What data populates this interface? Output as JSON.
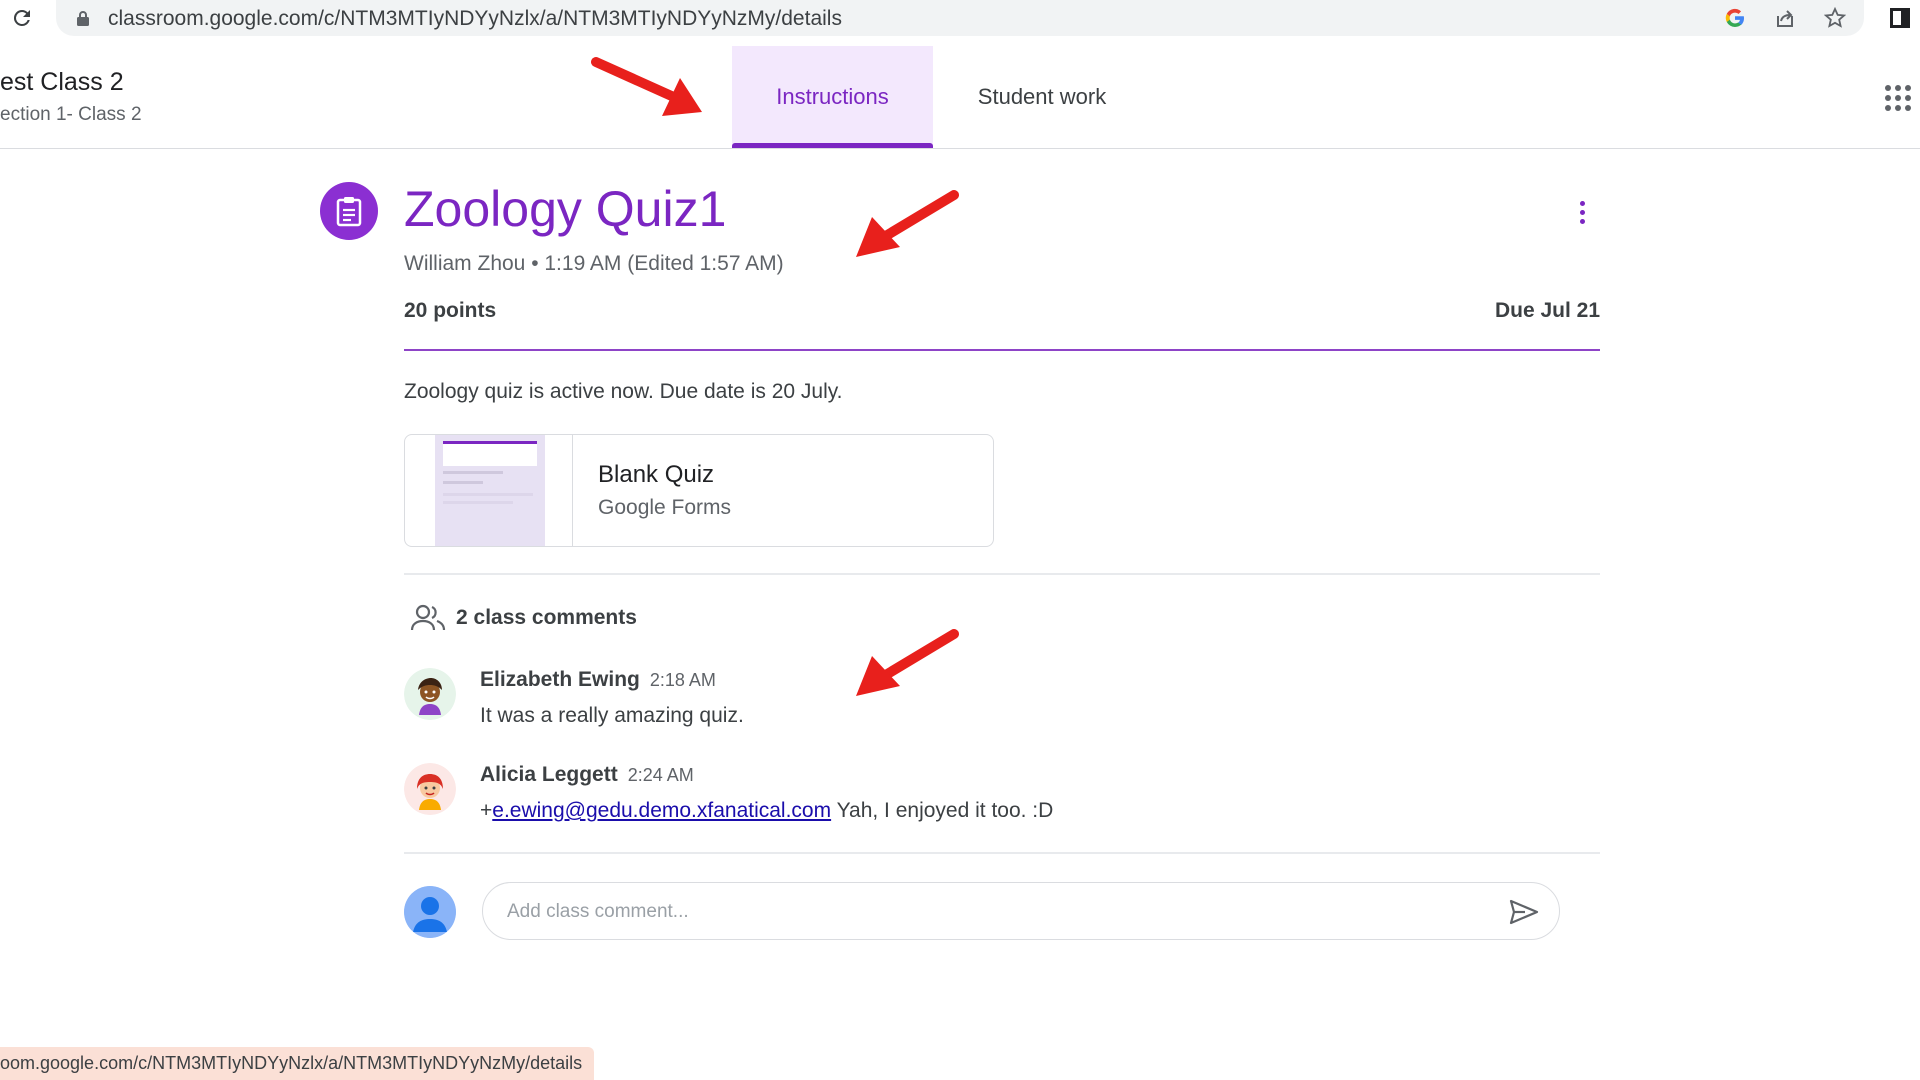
{
  "browser": {
    "url": "classroom.google.com/c/NTM3MTIyNDYyNzlx/a/NTM3MTIyNDYyNzMy/details",
    "status_url": "oom.google.com/c/NTM3MTIyNDYyNzlx/a/NTM3MTIyNDYyNzMy/details"
  },
  "header": {
    "class_name": "est Class 2",
    "class_section": "ection 1- Class 2",
    "tabs": [
      {
        "label": "Instructions",
        "active": true
      },
      {
        "label": "Student work",
        "active": false
      }
    ]
  },
  "assignment": {
    "title": "Zoology Quiz1",
    "meta": "William Zhou • 1:19 AM (Edited 1:57 AM)",
    "points": "20 points",
    "due": "Due Jul 21",
    "description": "Zoology quiz is active now. Due date is 20 July.",
    "attachment": {
      "title": "Blank Quiz",
      "source": "Google Forms"
    }
  },
  "comments": {
    "count_label": "2 class comments",
    "items": [
      {
        "author": "Elizabeth Ewing",
        "time": "2:18 AM",
        "mention": "",
        "prefix": "",
        "text": "It was a really amazing quiz."
      },
      {
        "author": "Alicia Leggett",
        "time": "2:24 AM",
        "prefix": "+",
        "mention": "e.ewing@gedu.demo.xfanatical.com",
        "text": " Yah, I enjoyed it too. :D"
      }
    ],
    "input_placeholder": "Add class comment..."
  },
  "icons": {
    "reload": "reload-icon",
    "lock": "lock-icon",
    "google": "google-icon",
    "share": "share-icon",
    "star": "star-icon",
    "apps": "apps-grid-icon",
    "assignment": "assignment-icon",
    "more": "more-vert-icon",
    "people": "people-icon",
    "send": "send-icon"
  },
  "colors": {
    "accent": "#7b26c2",
    "tab_active_bg": "#f3e8fd",
    "annotation": "#e8201c",
    "link": "#1a0dab"
  }
}
